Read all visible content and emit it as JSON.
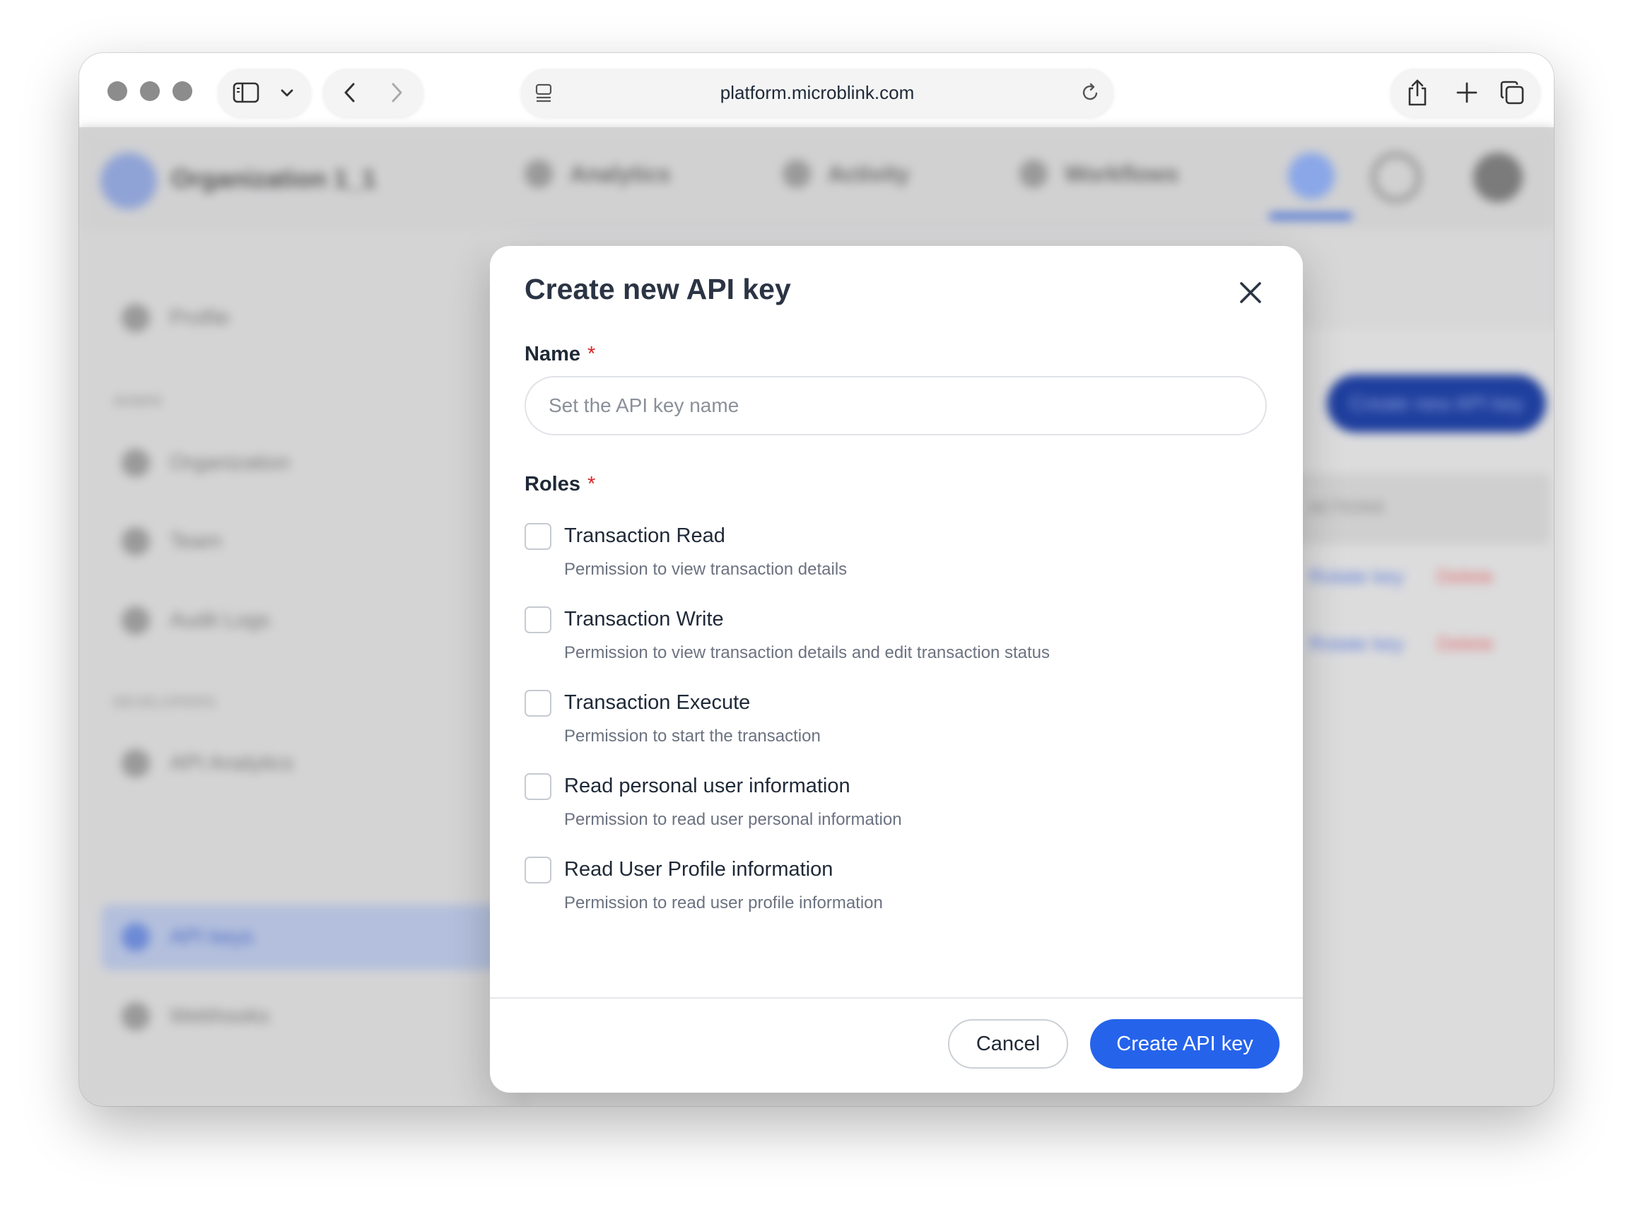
{
  "browser": {
    "url": "platform.microblink.com"
  },
  "background": {
    "org_name": "Organization 1_1",
    "nav": [
      "Analytics",
      "Activity",
      "Workflows"
    ],
    "sidebar": {
      "profile": "Profile",
      "admin_section": "ADMIN",
      "organization": "Organization",
      "team": "Team",
      "audit_logs": "Audit Logs",
      "developers_section": "DEVELOPERS",
      "api_analytics": "API Analytics",
      "api_keys": "API keys",
      "webhooks": "Webhooks"
    },
    "create_button": "Create new API key",
    "actions_header": "ACTIONS",
    "rotate_key": "Rotate key",
    "delete": "Delete"
  },
  "modal": {
    "title": "Create new API key",
    "name_label": "Name",
    "required_mark": "*",
    "name_placeholder": "Set the API key name",
    "roles_label": "Roles",
    "roles": [
      {
        "title": "Transaction Read",
        "description": "Permission to view transaction details",
        "checked": false
      },
      {
        "title": "Transaction Write",
        "description": "Permission to view transaction details and edit transaction status",
        "checked": false
      },
      {
        "title": "Transaction Execute",
        "description": "Permission to start the transaction",
        "checked": false
      },
      {
        "title": "Read personal user information",
        "description": "Permission to read user personal information",
        "checked": false
      },
      {
        "title": "Read User Profile information",
        "description": "Permission to read user profile information",
        "checked": false
      }
    ],
    "cancel_label": "Cancel",
    "create_label": "Create API key"
  },
  "colors": {
    "primary": "#2563eb",
    "required": "#dc2626"
  }
}
